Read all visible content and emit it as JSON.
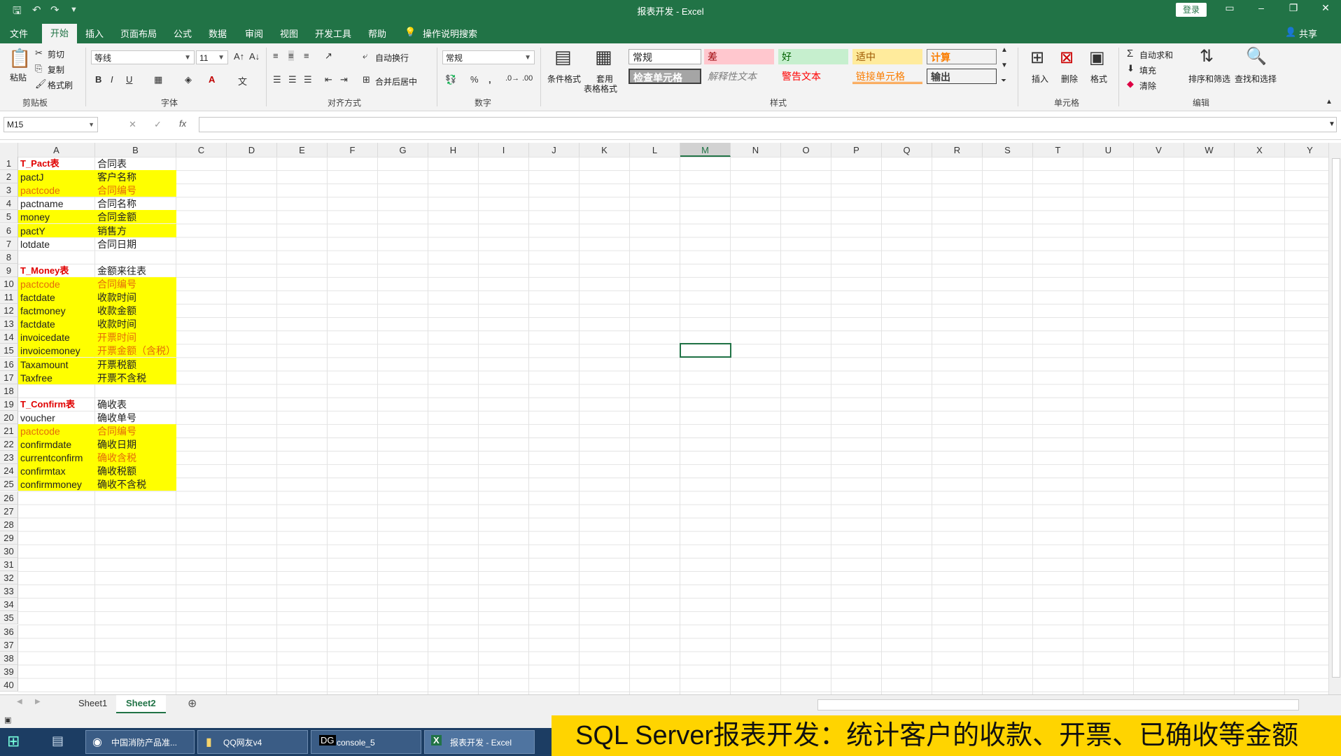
{
  "window": {
    "title": "报表开发  -  Excel",
    "login_label": "登录",
    "minimize_glyph": "–",
    "restore_glyph": "❐",
    "close_glyph": "✕"
  },
  "tabs": [
    "文件",
    "开始",
    "插入",
    "页面布局",
    "公式",
    "数据",
    "审阅",
    "视图",
    "开发工具",
    "帮助"
  ],
  "tell_me": "操作说明搜索",
  "share_label": "共享",
  "ribbon": {
    "clipboard": {
      "paste": "粘贴",
      "cut": "剪切",
      "copy": "复制",
      "format_painter": "格式刷",
      "label": "剪贴板"
    },
    "font": {
      "name": "等线",
      "size": "11",
      "label": "字体",
      "bold": "B",
      "italic": "I",
      "underline": "U"
    },
    "alignment": {
      "wrap": "自动换行",
      "merge": "合并后居中",
      "label": "对齐方式"
    },
    "number": {
      "format": "常规",
      "percent": "%",
      "comma": ",",
      "label": "数字"
    },
    "styles": {
      "conditional": "条件格式",
      "table_format_line1": "套用",
      "table_format_line2": "表格格式",
      "cells": [
        "常规",
        "差",
        "好",
        "适中",
        "计算",
        "检查单元格",
        "解释性文本",
        "警告文本",
        "链接单元格",
        "输出"
      ],
      "label": "样式"
    },
    "cells": {
      "insert": "插入",
      "delete": "删除",
      "format": "格式",
      "label": "单元格"
    },
    "editing": {
      "autosum": "自动求和",
      "fill": "填充",
      "clear": "清除",
      "sort": "排序和筛选",
      "find": "查找和选择",
      "label": "编辑"
    }
  },
  "formula_bar": {
    "name_box": "M15",
    "fx": "fx",
    "cancel": "✕",
    "enter": "✓",
    "value": ""
  },
  "columns": [
    "A",
    "B",
    "C",
    "D",
    "E",
    "F",
    "G",
    "H",
    "I",
    "J",
    "K",
    "L",
    "M",
    "N",
    "O",
    "P",
    "Q",
    "R",
    "S",
    "T",
    "U",
    "V",
    "W",
    "X",
    "Y"
  ],
  "selected_column": "M",
  "rows": [
    "1",
    "2",
    "3",
    "4",
    "5",
    "6",
    "7",
    "8",
    "9",
    "10",
    "11",
    "12",
    "13",
    "14",
    "15",
    "16",
    "17",
    "18",
    "19",
    "20",
    "21",
    "22",
    "23",
    "24",
    "25",
    "26",
    "27",
    "28",
    "29",
    "30",
    "31",
    "32",
    "33",
    "34",
    "35",
    "36",
    "37",
    "38",
    "39",
    "40"
  ],
  "sheet_cells": [
    {
      "row": 1,
      "a": "T_Pact表",
      "b": "合同表",
      "a_style": "red-bold",
      "b_style": "",
      "fill": false
    },
    {
      "row": 2,
      "a": "pactJ",
      "b": "客户名称",
      "a_style": "",
      "b_style": "",
      "fill": true
    },
    {
      "row": 3,
      "a": "pactcode",
      "b": "合同编号",
      "a_style": "orange",
      "b_style": "orange",
      "fill": true
    },
    {
      "row": 4,
      "a": "pactname",
      "b": "合同名称",
      "a_style": "",
      "b_style": "",
      "fill": false
    },
    {
      "row": 5,
      "a": "money",
      "b": "合同金额",
      "a_style": "",
      "b_style": "",
      "fill": true
    },
    {
      "row": 6,
      "a": "pactY",
      "b": "销售方",
      "a_style": "",
      "b_style": "",
      "fill": true
    },
    {
      "row": 7,
      "a": "lotdate",
      "b": "合同日期",
      "a_style": "",
      "b_style": "",
      "fill": false
    },
    {
      "row": 9,
      "a": "T_Money表",
      "b": "金额来往表",
      "a_style": "red-bold",
      "b_style": "",
      "fill": false
    },
    {
      "row": 10,
      "a": "pactcode",
      "b": "合同编号",
      "a_style": "orange",
      "b_style": "orange",
      "fill": true
    },
    {
      "row": 11,
      "a": "factdate",
      "b": "收款时间",
      "a_style": "",
      "b_style": "",
      "fill": true
    },
    {
      "row": 12,
      "a": "factmoney",
      "b": "收款金额",
      "a_style": "",
      "b_style": "",
      "fill": true
    },
    {
      "row": 13,
      "a": "factdate",
      "b": "收款时间",
      "a_style": "",
      "b_style": "",
      "fill": true
    },
    {
      "row": 14,
      "a": "invoicedate",
      "b": "开票时间",
      "a_style": "",
      "b_style": "orange",
      "fill": true
    },
    {
      "row": 15,
      "a": "invoicemoney",
      "b": "开票金额（含税）",
      "a_style": "",
      "b_style": "orange",
      "fill": true
    },
    {
      "row": 16,
      "a": "Taxamount",
      "b": "开票税额",
      "a_style": "",
      "b_style": "",
      "fill": true
    },
    {
      "row": 17,
      "a": "Taxfree",
      "b": "开票不含税",
      "a_style": "",
      "b_style": "",
      "fill": true
    },
    {
      "row": 19,
      "a": "T_Confirm表",
      "b": "确收表",
      "a_style": "red-bold",
      "b_style": "",
      "fill": false
    },
    {
      "row": 20,
      "a": "voucher",
      "b": "确收单号",
      "a_style": "",
      "b_style": "",
      "fill": false
    },
    {
      "row": 21,
      "a": "pactcode",
      "b": "合同编号",
      "a_style": "orange",
      "b_style": "orange",
      "fill": true
    },
    {
      "row": 22,
      "a": "confirmdate",
      "b": "确收日期",
      "a_style": "",
      "b_style": "",
      "fill": true
    },
    {
      "row": 23,
      "a": "currentconfirm",
      "b": "确收含税",
      "a_style": "",
      "b_style": "orange",
      "fill": true
    },
    {
      "row": 24,
      "a": "confirmtax",
      "b": "确收税额",
      "a_style": "",
      "b_style": "",
      "fill": true
    },
    {
      "row": 25,
      "a": "confirmmoney",
      "b": "确收不含税",
      "a_style": "",
      "b_style": "",
      "fill": true
    }
  ],
  "selected_cell": "M15",
  "sheet_tabs": [
    "Sheet1",
    "Sheet2"
  ],
  "active_sheet": "Sheet2",
  "add_sheet": "⊕",
  "taskbar": {
    "items": [
      "中国消防产品准...",
      "QQ网友v4",
      "console_5",
      "报表开发 - Excel"
    ]
  },
  "caption": "SQL Server报表开发：统计客户的收款、开票、已确收等金额",
  "colors": {
    "excel_green": "#217346",
    "highlight_yellow": "#ffff00",
    "caption_yellow": "#ffd400"
  }
}
